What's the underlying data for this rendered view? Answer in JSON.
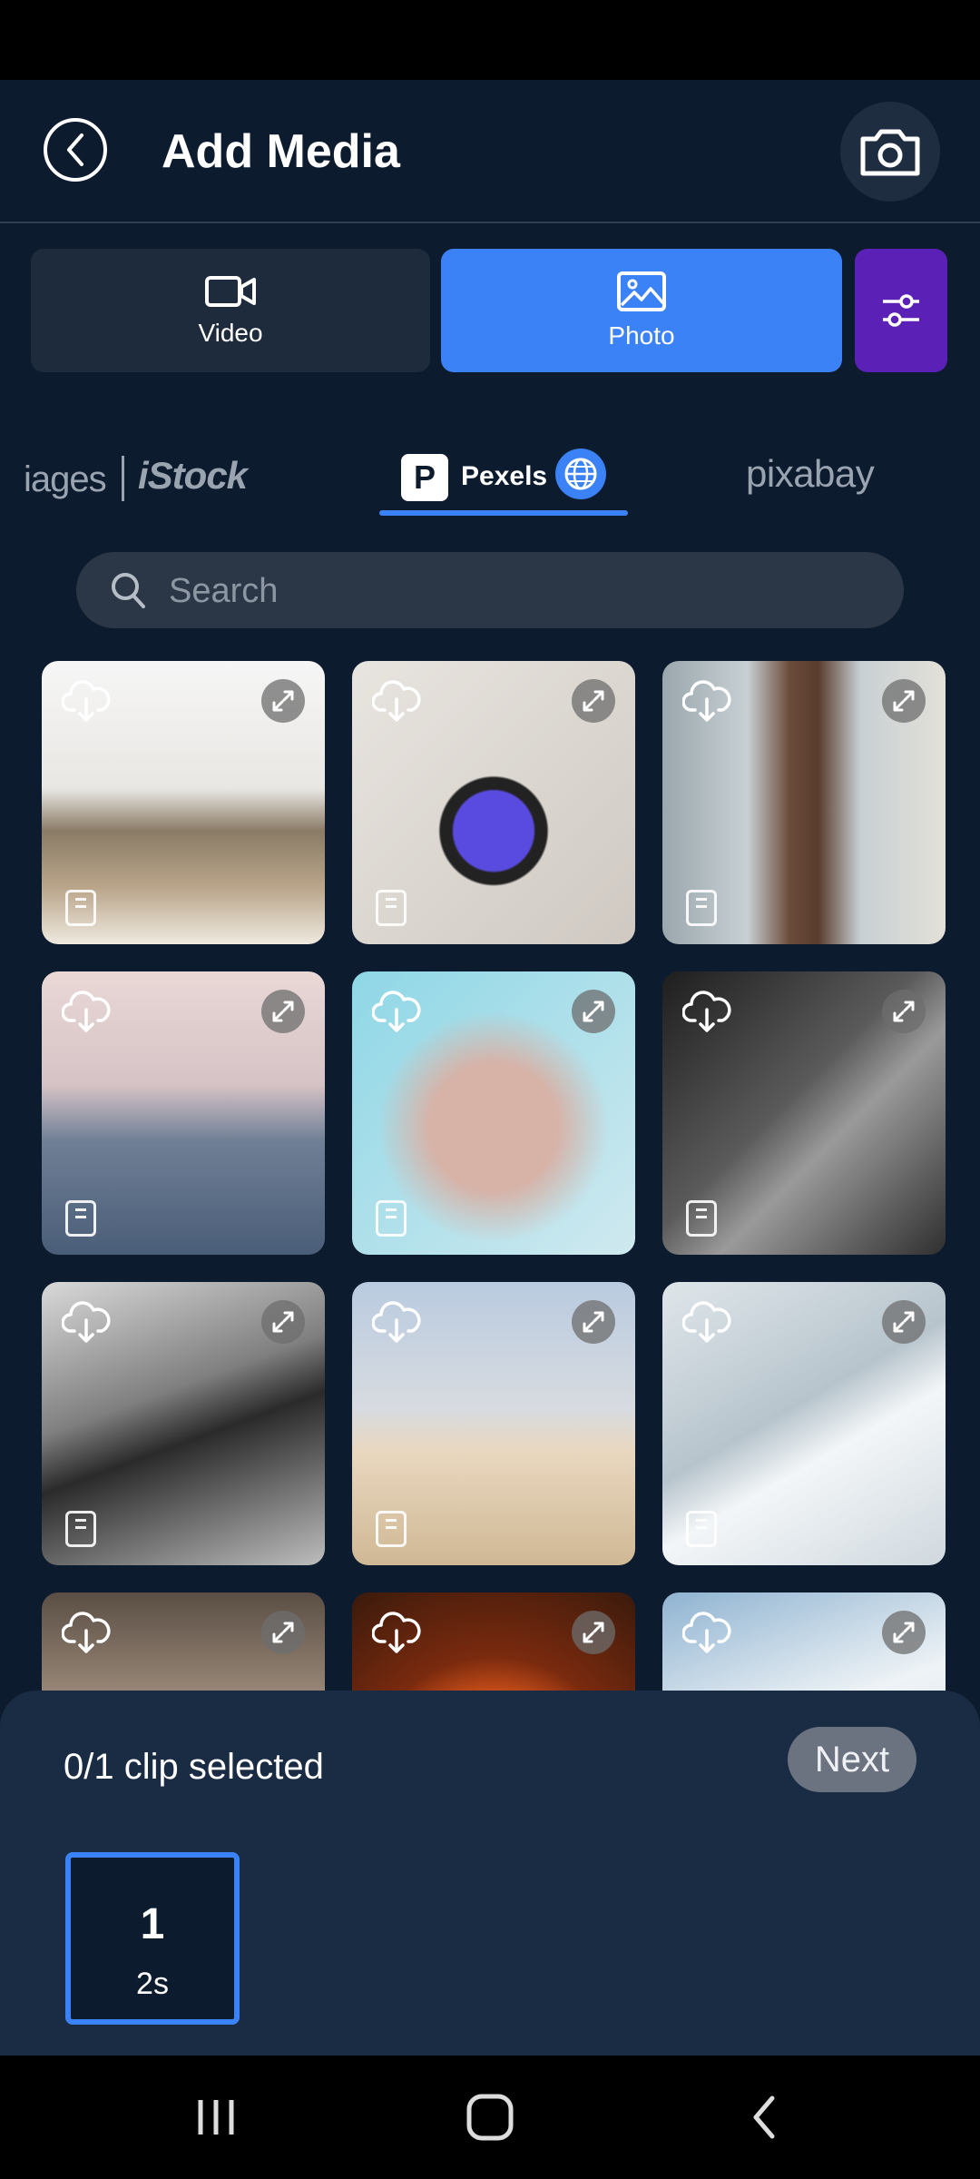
{
  "header": {
    "title": "Add Media"
  },
  "type_tabs": [
    {
      "label": "Video",
      "icon": "video-camera-icon",
      "selected": false
    },
    {
      "label": "Photo",
      "icon": "image-icon",
      "selected": true
    }
  ],
  "sources": {
    "partial": "iages",
    "istock": "iStock",
    "pexels": "Pexels",
    "pexels_logo": "P",
    "pixabay": "pixabay",
    "active": "Pexels"
  },
  "search": {
    "placeholder": "Search",
    "value": ""
  },
  "grid": {
    "tiles": [
      {
        "subject": "pier over water"
      },
      {
        "subject": "tablet and camera flatlay"
      },
      {
        "subject": "clock tower"
      },
      {
        "subject": "bay bridge"
      },
      {
        "subject": "veiled face"
      },
      {
        "subject": "woman in tank top"
      },
      {
        "subject": "person in surf"
      },
      {
        "subject": "man on stairs"
      },
      {
        "subject": "snow peak"
      },
      {
        "subject": "man portrait"
      },
      {
        "subject": "tomato"
      },
      {
        "subject": "white blossoms"
      }
    ]
  },
  "selection": {
    "count_text": "0/1 clip selected",
    "next_label": "Next",
    "slot_number": "1",
    "slot_duration": "2s"
  },
  "colors": {
    "background": "#0d1b2e",
    "accent": "#3b82f6",
    "filter": "#5b21b6"
  }
}
